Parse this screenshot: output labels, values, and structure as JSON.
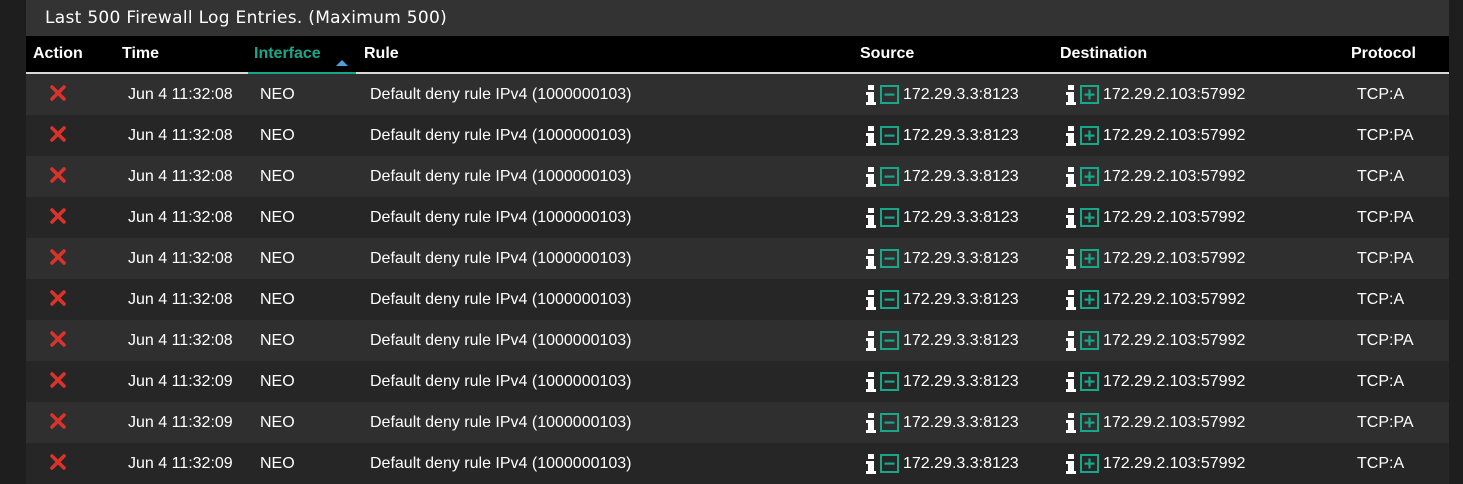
{
  "panel": {
    "title": "Last 500 Firewall Log Entries. (Maximum 500)"
  },
  "table": {
    "headers": {
      "action": "Action",
      "time": "Time",
      "interface": "Interface",
      "rule": "Rule",
      "source": "Source",
      "destination": "Destination",
      "protocol": "Protocol"
    },
    "sorted_by": "interface",
    "sort_direction": "ascending",
    "rows": [
      {
        "action": "block",
        "time": "Jun 4 11:32:08",
        "interface": "NEO",
        "rule": "Default deny rule IPv4 (1000000103)",
        "source": "172.29.3.3:8123",
        "destination": "172.29.2.103:57992",
        "protocol": "TCP:A"
      },
      {
        "action": "block",
        "time": "Jun 4 11:32:08",
        "interface": "NEO",
        "rule": "Default deny rule IPv4 (1000000103)",
        "source": "172.29.3.3:8123",
        "destination": "172.29.2.103:57992",
        "protocol": "TCP:PA"
      },
      {
        "action": "block",
        "time": "Jun 4 11:32:08",
        "interface": "NEO",
        "rule": "Default deny rule IPv4 (1000000103)",
        "source": "172.29.3.3:8123",
        "destination": "172.29.2.103:57992",
        "protocol": "TCP:A"
      },
      {
        "action": "block",
        "time": "Jun 4 11:32:08",
        "interface": "NEO",
        "rule": "Default deny rule IPv4 (1000000103)",
        "source": "172.29.3.3:8123",
        "destination": "172.29.2.103:57992",
        "protocol": "TCP:PA"
      },
      {
        "action": "block",
        "time": "Jun 4 11:32:08",
        "interface": "NEO",
        "rule": "Default deny rule IPv4 (1000000103)",
        "source": "172.29.3.3:8123",
        "destination": "172.29.2.103:57992",
        "protocol": "TCP:PA"
      },
      {
        "action": "block",
        "time": "Jun 4 11:32:08",
        "interface": "NEO",
        "rule": "Default deny rule IPv4 (1000000103)",
        "source": "172.29.3.3:8123",
        "destination": "172.29.2.103:57992",
        "protocol": "TCP:A"
      },
      {
        "action": "block",
        "time": "Jun 4 11:32:08",
        "interface": "NEO",
        "rule": "Default deny rule IPv4 (1000000103)",
        "source": "172.29.3.3:8123",
        "destination": "172.29.2.103:57992",
        "protocol": "TCP:PA"
      },
      {
        "action": "block",
        "time": "Jun 4 11:32:09",
        "interface": "NEO",
        "rule": "Default deny rule IPv4 (1000000103)",
        "source": "172.29.3.3:8123",
        "destination": "172.29.2.103:57992",
        "protocol": "TCP:A"
      },
      {
        "action": "block",
        "time": "Jun 4 11:32:09",
        "interface": "NEO",
        "rule": "Default deny rule IPv4 (1000000103)",
        "source": "172.29.3.3:8123",
        "destination": "172.29.2.103:57992",
        "protocol": "TCP:PA"
      },
      {
        "action": "block",
        "time": "Jun 4 11:32:09",
        "interface": "NEO",
        "rule": "Default deny rule IPv4 (1000000103)",
        "source": "172.29.3.3:8123",
        "destination": "172.29.2.103:57992",
        "protocol": "TCP:A"
      }
    ]
  },
  "icons": {
    "action": "block-x-icon",
    "info": "info-icon",
    "source_box": "minus-square-icon",
    "destination_box": "plus-square-icon"
  },
  "colors": {
    "block": "#d9332b",
    "accent": "#17a78a",
    "sort_arrow": "#4aa3df",
    "header_bg": "#000000",
    "row_odd": "#2f2f2f",
    "row_even": "#262626"
  }
}
